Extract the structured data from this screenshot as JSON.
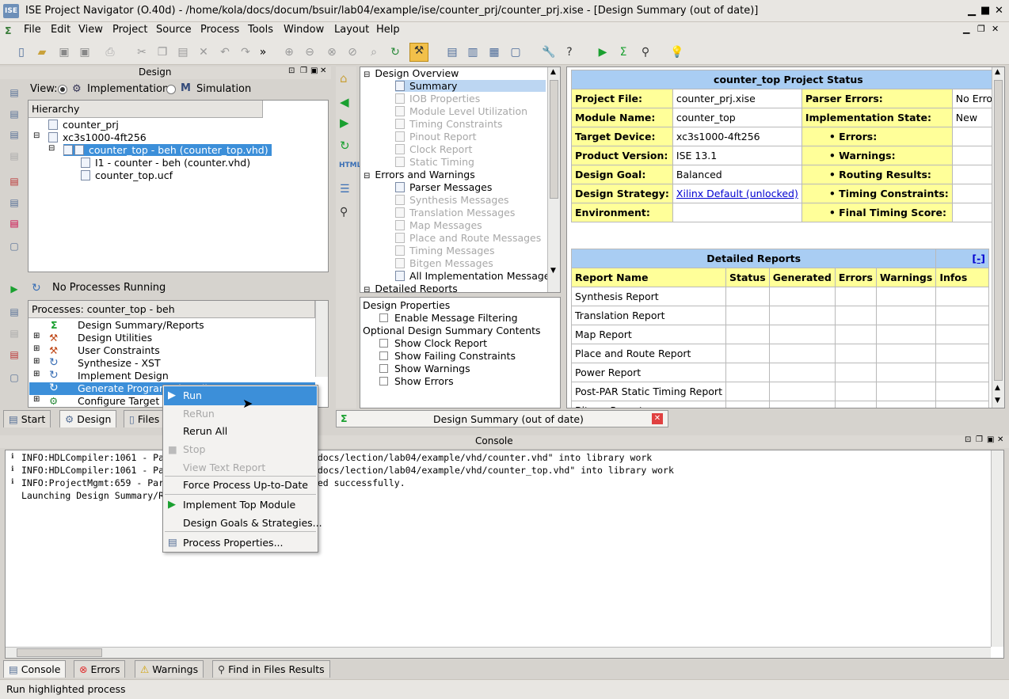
{
  "window": {
    "title": "ISE Project Navigator (O.40d) - /home/kola/docs/docum/bsuir/lab04/example/ise/counter_prj/counter_prj.xise - [Design Summary (out of date)]",
    "logo": "ISE"
  },
  "menu": [
    "File",
    "Edit",
    "View",
    "Project",
    "Source",
    "Process",
    "Tools",
    "Window",
    "Layout",
    "Help"
  ],
  "design_panel": {
    "title": "Design",
    "view_label": "View:",
    "view_impl": "Implementation",
    "view_sim": "Simulation",
    "hierarchy_header": "Hierarchy",
    "tree": [
      "counter_prj",
      "xc3s1000-4ft256",
      "counter_top - beh (counter_top.vhd)",
      "I1 - counter - beh (counter.vhd)",
      "counter_top.ucf"
    ]
  },
  "processes": {
    "status": "No Processes Running",
    "header": "Processes: counter_top - beh",
    "items": [
      "Design Summary/Reports",
      "Design Utilities",
      "User Constraints",
      "Synthesize - XST",
      "Implement Design",
      "Generate Programming File",
      "Configure Target Device"
    ]
  },
  "left_tabs": [
    "Start",
    "Design",
    "Files"
  ],
  "overview": {
    "items": [
      {
        "label": "Design Overview",
        "level": 0,
        "state": "normal"
      },
      {
        "label": "Summary",
        "level": 1,
        "state": "selected"
      },
      {
        "label": "IOB Properties",
        "level": 1,
        "state": "disabled"
      },
      {
        "label": "Module Level Utilization",
        "level": 1,
        "state": "disabled"
      },
      {
        "label": "Timing Constraints",
        "level": 1,
        "state": "disabled"
      },
      {
        "label": "Pinout Report",
        "level": 1,
        "state": "disabled"
      },
      {
        "label": "Clock Report",
        "level": 1,
        "state": "disabled"
      },
      {
        "label": "Static Timing",
        "level": 1,
        "state": "disabled"
      },
      {
        "label": "Errors and Warnings",
        "level": 0,
        "state": "normal"
      },
      {
        "label": "Parser Messages",
        "level": 1,
        "state": "normal"
      },
      {
        "label": "Synthesis Messages",
        "level": 1,
        "state": "disabled"
      },
      {
        "label": "Translation Messages",
        "level": 1,
        "state": "disabled"
      },
      {
        "label": "Map Messages",
        "level": 1,
        "state": "disabled"
      },
      {
        "label": "Place and Route Messages",
        "level": 1,
        "state": "disabled"
      },
      {
        "label": "Timing Messages",
        "level": 1,
        "state": "disabled"
      },
      {
        "label": "Bitgen Messages",
        "level": 1,
        "state": "disabled"
      },
      {
        "label": "All Implementation Messages",
        "level": 1,
        "state": "normal"
      },
      {
        "label": "Detailed Reports",
        "level": 0,
        "state": "normal"
      }
    ]
  },
  "properties": {
    "design_props": "Design Properties",
    "enable_filter": "Enable Message Filtering",
    "optional": "Optional Design Summary Contents",
    "show_clock": "Show Clock Report",
    "show_failing": "Show Failing Constraints",
    "show_warnings": "Show Warnings",
    "show_errors": "Show Errors"
  },
  "summary": {
    "title": "counter_top Project Status",
    "rows": [
      {
        "k1": "Project File:",
        "v1": "counter_prj.xise",
        "k2": "Parser Errors:",
        "v2": "No Errors"
      },
      {
        "k1": "Module Name:",
        "v1": "counter_top",
        "k2": "Implementation State:",
        "v2": "New"
      },
      {
        "k1": "Target Device:",
        "v1": "xc3s1000-4ft256",
        "k2": "• Errors:",
        "v2": ""
      },
      {
        "k1": "Product Version:",
        "v1": "ISE 13.1",
        "k2": "• Warnings:",
        "v2": ""
      },
      {
        "k1": "Design Goal:",
        "v1": "Balanced",
        "k2": "• Routing Results:",
        "v2": ""
      },
      {
        "k1": "Design Strategy:",
        "v1": "Xilinx Default (unlocked)",
        "k2": "• Timing Constraints:",
        "v2": ""
      },
      {
        "k1": "Environment:",
        "v1": "",
        "k2": "• Final Timing Score:",
        "v2": ""
      }
    ],
    "detailed_title": "Detailed Reports",
    "collapse": "[-]",
    "detail_headers": [
      "Report Name",
      "Status",
      "Generated",
      "Errors",
      "Warnings",
      "Infos"
    ],
    "detail_rows": [
      "Synthesis Report",
      "Translation Report",
      "Map Report",
      "Place and Route Report",
      "Power Report",
      "Post-PAR Static Timing Report",
      "Bitgen Report"
    ]
  },
  "doc_tab": "Design Summary (out of date)",
  "console": {
    "title": "Console",
    "lines": [
      "INFO:HDLCompiler:1061 - Parsing VHDL file \"/home/kola/docs/lection/lab04/example/vhd/counter.vhd\" into library work",
      "INFO:HDLCompiler:1061 - Parsing VHDL file \"/home/kola/docs/lection/lab04/example/vhd/counter_top.vhd\" into library work",
      "INFO:ProjectMgmt:659 - Parsing of project file completed successfully.",
      "Launching Design Summary/Report Viewer..."
    ],
    "tabs": [
      "Console",
      "Errors",
      "Warnings",
      "Find in Files Results"
    ]
  },
  "context_menu": {
    "items": [
      {
        "label": "Run",
        "state": "highlighted"
      },
      {
        "label": "ReRun",
        "state": "disabled"
      },
      {
        "label": "Rerun All",
        "state": "normal"
      },
      {
        "label": "Stop",
        "state": "disabled"
      },
      {
        "label": "View Text Report",
        "state": "disabled"
      },
      {
        "label": "Force Process Up-to-Date",
        "state": "normal"
      },
      {
        "label": "Implement Top Module",
        "state": "normal"
      },
      {
        "label": "Design Goals & Strategies...",
        "state": "normal"
      },
      {
        "label": "Process Properties...",
        "state": "normal"
      }
    ]
  },
  "statusbar": "Run highlighted process",
  "colors": {
    "selection": "#3c8fd9",
    "yellow": "#ffff99",
    "header_blue": "#a9cdf3"
  }
}
